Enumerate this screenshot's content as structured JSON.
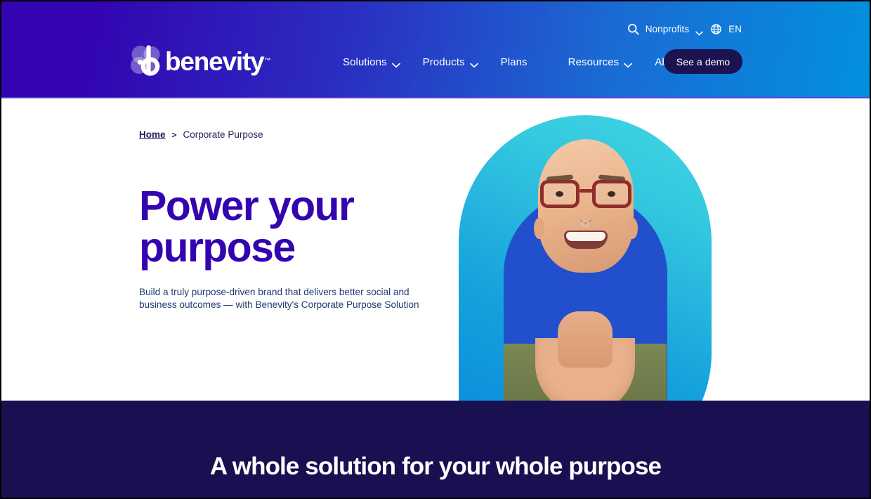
{
  "header": {
    "utility": {
      "search_icon": "search-icon",
      "audience_label": "Nonprofits",
      "audience_chevron": "chevron-down-icon",
      "globe_icon": "globe-icon",
      "language": "EN"
    },
    "logo": {
      "wordmark": "benevity",
      "trademark": "™",
      "mark_icon": "benevity-b-mark-icon"
    },
    "nav": [
      {
        "label": "Solutions",
        "has_chevron": true
      },
      {
        "label": "Products",
        "has_chevron": true
      },
      {
        "label": "Plans",
        "has_chevron": false
      },
      {
        "label": "Resources",
        "has_chevron": true
      },
      {
        "label": "About us",
        "has_chevron": true
      }
    ],
    "cta": {
      "label": "See a demo"
    },
    "colors": {
      "gradient_start": "#3304B0",
      "gradient_end": "#0291DE",
      "cta_bg": "#1B1250"
    }
  },
  "hero": {
    "breadcrumb": {
      "home": "Home",
      "separator": ">",
      "current": "Corporate Purpose"
    },
    "title": "Power your purpose",
    "subtitle": "Build a truly purpose-driven brand that delivers better social and business outcomes — with Benevity's Corporate Purpose Solution",
    "image_alt": "smiling-person-portrait",
    "colors": {
      "title": "#3304B0",
      "subtitle": "#1F3B72",
      "blob_start": "#3FD5E2",
      "blob_end": "#0E8ED9",
      "blob_inner": "#2250CC"
    }
  },
  "band": {
    "title": "A whole solution for your whole purpose",
    "background": "#191052"
  }
}
